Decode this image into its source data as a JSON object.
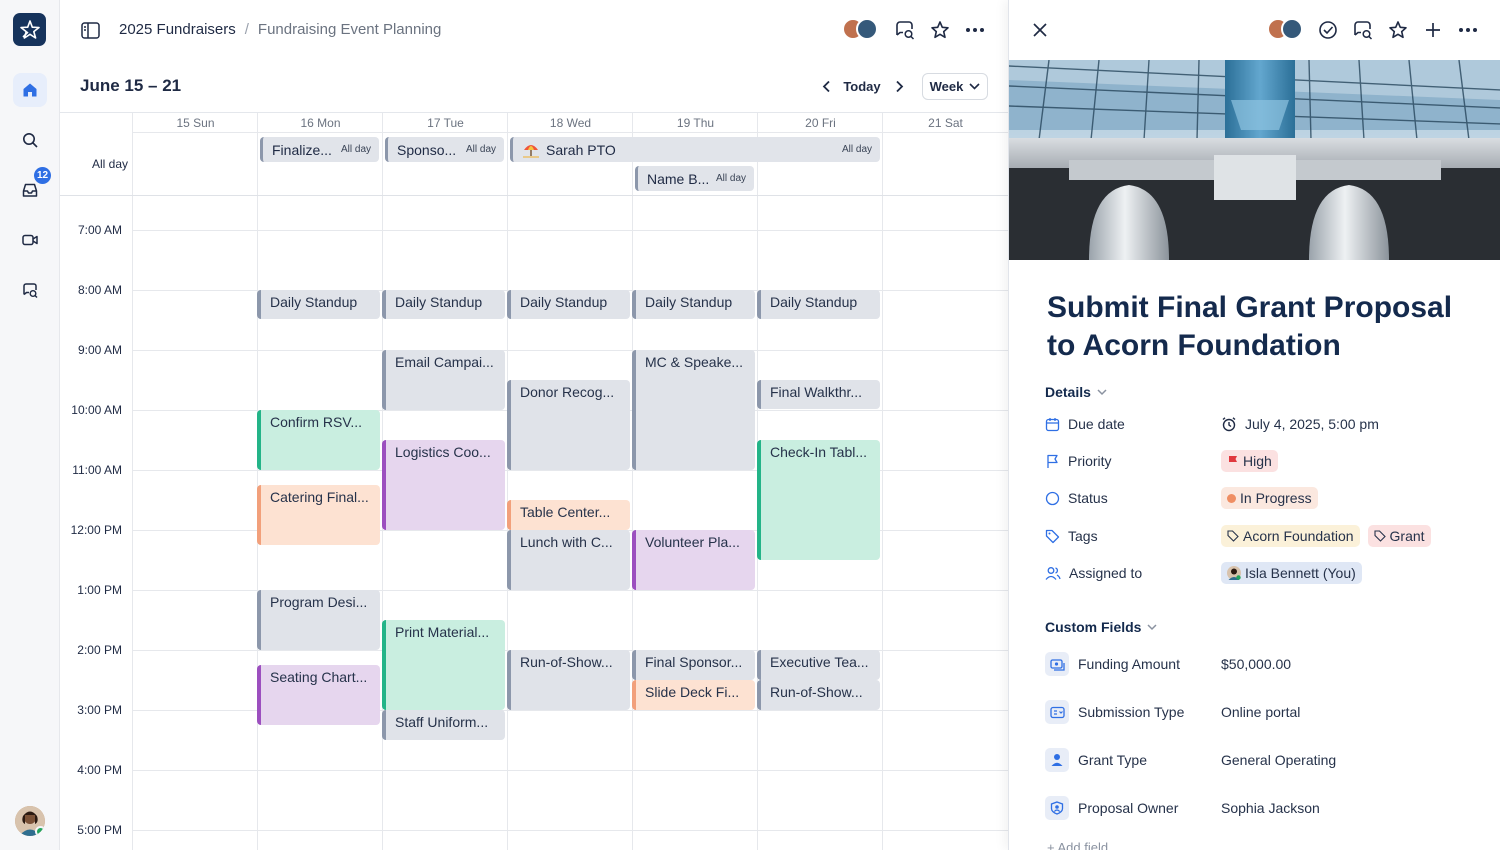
{
  "breadcrumb": {
    "space": "2025 Fundraisers",
    "separator": "/",
    "page": "Fundraising Event Planning"
  },
  "rail": {
    "inbox_badge": "12"
  },
  "calendar": {
    "range": "June 15 – 21",
    "today_label": "Today",
    "view_label": "Week",
    "allday_label": "All day",
    "days": [
      "15 Sun",
      "16 Mon",
      "17 Tue",
      "18 Wed",
      "19 Thu",
      "20 Fri",
      "21 Sat"
    ],
    "hours": [
      "7:00 AM",
      "8:00 AM",
      "9:00 AM",
      "10:00 AM",
      "11:00 AM",
      "12:00 PM",
      "1:00 PM",
      "2:00 PM",
      "3:00 PM",
      "4:00 PM",
      "5:00 PM"
    ],
    "allday_tag": "All day",
    "allday_events": [
      {
        "title": "Finalize...",
        "tag": "All day"
      },
      {
        "title": "Sponso...",
        "tag": "All day"
      },
      {
        "title": "Sarah PTO",
        "tag": "All day"
      },
      {
        "title": "Name B...",
        "tag": "All day"
      }
    ],
    "events": [
      "Daily Standup",
      "Daily Standup",
      "Daily Standup",
      "Daily Standup",
      "Daily Standup",
      "Email Campai...",
      "MC & Speake...",
      "Donor Recog...",
      "Final Walkthr...",
      "Confirm RSV...",
      "Logistics Coo...",
      "Check-In Tabl...",
      "Catering Final...",
      "Table Center...",
      "Lunch with C...",
      "Volunteer Pla...",
      "Program Desi...",
      "Print Material...",
      "Run-of-Show...",
      "Final Sponsor...",
      "Executive Tea...",
      "Seating Chart...",
      "Slide Deck Fi...",
      "Run-of-Show...",
      "Staff Uniform..."
    ]
  },
  "task": {
    "title": "Submit Final Grant Proposal to Acorn Foundation",
    "details_label": "Details",
    "due_label": "Due date",
    "due_value": "July 4, 2025, 5:00 pm",
    "priority_label": "Priority",
    "priority_value": "High",
    "status_label": "Status",
    "status_value": "In Progress",
    "tags_label": "Tags",
    "tags": [
      "Acorn Foundation",
      "Grant"
    ],
    "assigned_label": "Assigned to",
    "assigned_value": "Isla Bennett (You)",
    "custom_label": "Custom Fields",
    "custom": [
      {
        "label": "Funding Amount",
        "value": "$50,000.00"
      },
      {
        "label": "Submission Type",
        "value": "Online portal"
      },
      {
        "label": "Grant Type",
        "value": "General Operating"
      },
      {
        "label": "Proposal Owner",
        "value": "Sophia Jackson"
      }
    ],
    "add_field": "+ Add field"
  },
  "colors": {
    "accent": "#2f6fe4",
    "navy": "#142a4d",
    "green": "#23b488",
    "purple": "#9c4fbf",
    "peach": "#f2a07b",
    "gray": "#8c97ab"
  }
}
